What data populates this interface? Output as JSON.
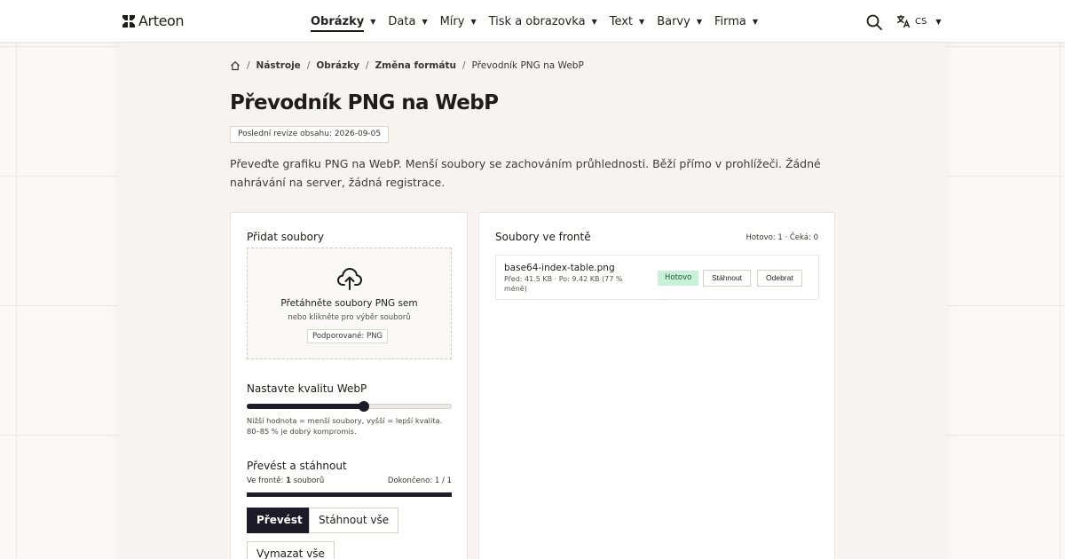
{
  "brand": {
    "name": "Arteon"
  },
  "nav": {
    "items": [
      {
        "label": "Obrázky"
      },
      {
        "label": "Data"
      },
      {
        "label": "Míry"
      },
      {
        "label": "Tisk a obrazovka"
      },
      {
        "label": "Text"
      },
      {
        "label": "Barvy"
      },
      {
        "label": "Firma"
      }
    ],
    "active_index": 0,
    "language": "CS"
  },
  "breadcrumb": {
    "items": [
      "Nástroje",
      "Obrázky",
      "Změna formátu"
    ],
    "current": "Převodník PNG na WebP"
  },
  "page": {
    "title": "Převodník PNG na WebP",
    "revision": "Poslední revize obsahu: 2026-09-05",
    "intro": "Převeďte grafiku PNG na WebP. Menší soubory se zachováním průhlednosti. Běží přímo v prohlížeči. Žádné nahrávání na server, žádná registrace."
  },
  "upload": {
    "title": "Přidat soubory",
    "drop_title": "Přetáhněte soubory PNG sem",
    "drop_sub": "nebo klikněte pro výběr souborů",
    "supported": "Podporované: PNG"
  },
  "quality": {
    "title": "Nastavte kvalitu WebP",
    "value": 0.57,
    "hint": "Nižší hodnota = menší soubory, vyšší = lepší kvalita. 80–85 % je dobrý kompromis."
  },
  "convert": {
    "title": "Převést a stáhnout",
    "queue_label": "Ve frontě: ",
    "queue_count": "1",
    "queue_unit": " souborů",
    "done_label": "Dokončeno: 1 / 1",
    "progress": 1.0,
    "buttons": {
      "convert": "Převést",
      "download_all": "Stáhnout vše",
      "clear_all": "Vymazat vše"
    }
  },
  "queue": {
    "title": "Soubory ve frontě",
    "stats": "Hotovo: 1 · Čeká: 0",
    "files": [
      {
        "name": "base64-index-table.png",
        "meta": "Před: 41.5 KB · Po: 9.42 KB (77 % méně)",
        "status": "Hotovo",
        "download_label": "Stáhnout",
        "remove_label": "Odebrat"
      }
    ]
  },
  "colors": {
    "accent": "#1c1b27",
    "status_done_bg": "#c9f1d9",
    "page_bg": "#faf7f4"
  },
  "icons": [
    "logo-mark-icon",
    "chevron-down-icon",
    "search-icon",
    "translate-icon",
    "home-icon",
    "cloud-upload-icon"
  ]
}
